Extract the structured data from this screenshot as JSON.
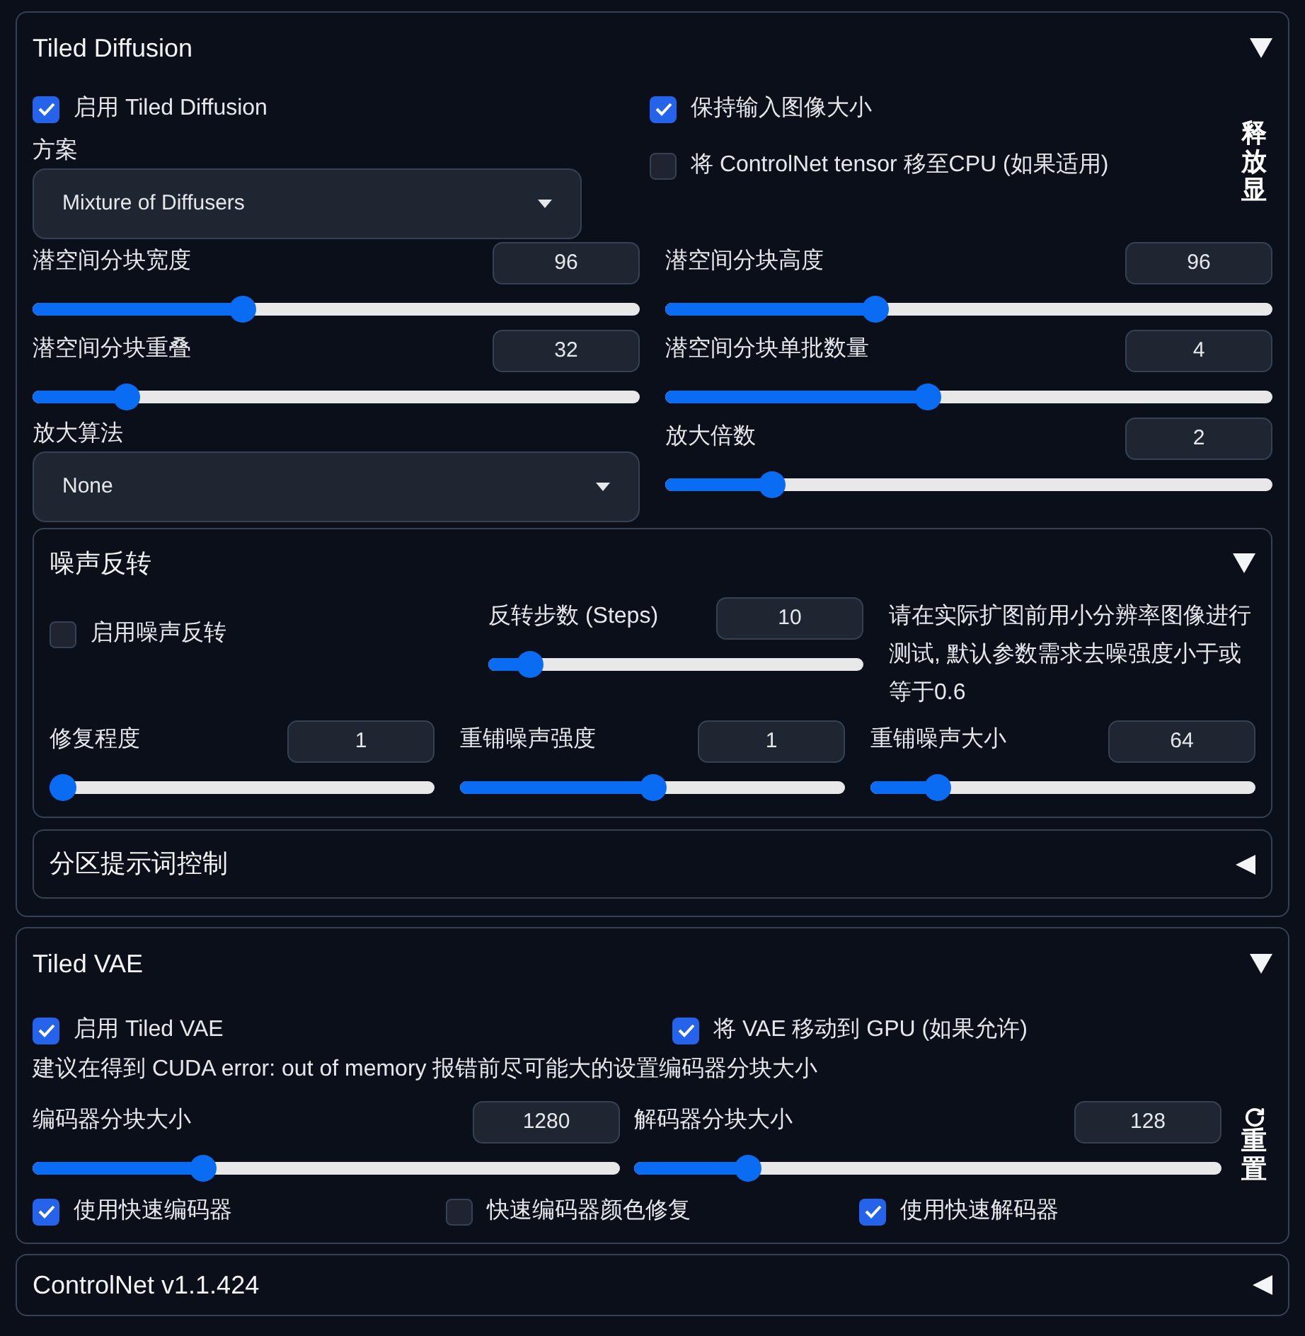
{
  "tiled_diffusion": {
    "title": "Tiled Diffusion",
    "expanded": true,
    "enable": {
      "label": "启用 Tiled Diffusion",
      "checked": true
    },
    "keep_size": {
      "label": "保持输入图像大小",
      "checked": true
    },
    "method": {
      "label": "方案",
      "value": "Mixture of Diffusers"
    },
    "controlnet_cpu": {
      "label": "将 ControlNet tensor 移至CPU (如果适用)",
      "checked": false
    },
    "free_vram_button": "释放显",
    "sliders": [
      {
        "label": "潜空间分块宽度",
        "value": "96",
        "level": 0.34
      },
      {
        "label": "潜空间分块高度",
        "value": "96",
        "level": 0.34
      },
      {
        "label": "潜空间分块重叠",
        "value": "32",
        "level": 0.14
      },
      {
        "label": "潜空间分块单批数量",
        "value": "4",
        "level": 0.43
      }
    ],
    "upscaler": {
      "label": "放大算法",
      "value": "None"
    },
    "scale": {
      "label": "放大倍数",
      "value": "2",
      "level": 0.16
    },
    "noise_inversion": {
      "title": "噪声反转",
      "expanded": true,
      "enable": {
        "label": "启用噪声反转",
        "checked": false
      },
      "steps": {
        "label": "反转步数 (Steps)",
        "value": "10",
        "level": 0.08
      },
      "note": "请在实际扩图前用小分辨率图像进行测试, 默认参数需求去噪强度小于或等于0.6",
      "sliders": [
        {
          "label": "修复程度",
          "value": "1",
          "level": 0.0
        },
        {
          "label": "重铺噪声强度",
          "value": "1",
          "level": 0.5
        },
        {
          "label": "重铺噪声大小",
          "value": "64",
          "level": 0.15
        }
      ]
    },
    "region_prompt": {
      "title": "分区提示词控制",
      "expanded": false
    }
  },
  "tiled_vae": {
    "title": "Tiled VAE",
    "expanded": true,
    "enable": {
      "label": "启用 Tiled VAE",
      "checked": true
    },
    "move_gpu": {
      "label": "将 VAE 移动到 GPU (如果允许)",
      "checked": true
    },
    "hint": "建议在得到 CUDA error: out of memory 报错前尽可能大的设置编码器分块大小",
    "sliders": [
      {
        "label": "编码器分块大小",
        "value": "1280",
        "level": 0.28
      },
      {
        "label": "解码器分块大小",
        "value": "128",
        "level": 0.18
      }
    ],
    "reset_button": "重置",
    "options": [
      {
        "label": "使用快速编码器",
        "checked": true
      },
      {
        "label": "快速编码器颜色修复",
        "checked": false
      },
      {
        "label": "使用快速解码器",
        "checked": true
      }
    ]
  },
  "controlnet": {
    "title": "ControlNet v1.1.424",
    "expanded": false
  }
}
